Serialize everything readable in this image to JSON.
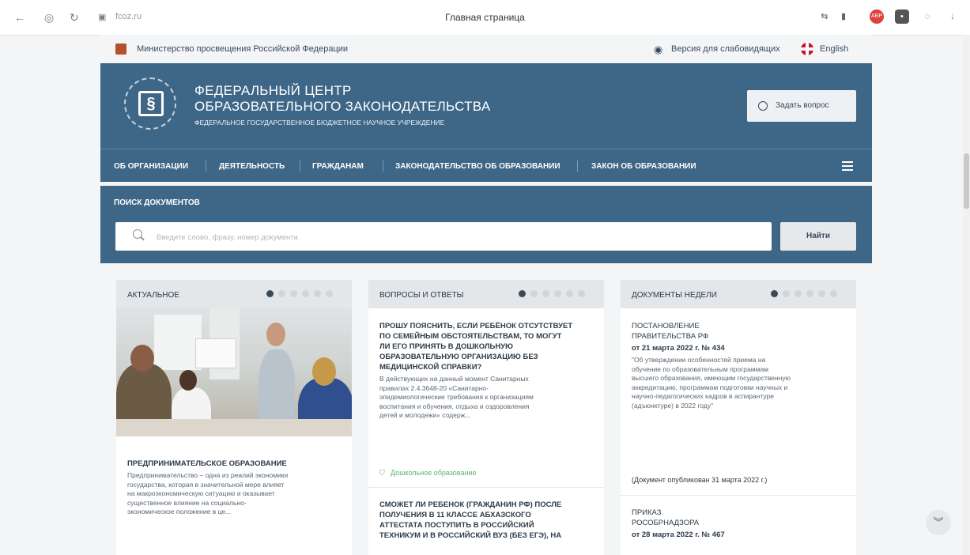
{
  "browser": {
    "url": "fcoz.ru",
    "tab_title": "Главная страница",
    "icons": [
      "back-icon",
      "shield-icon",
      "reload-icon",
      "lock-icon",
      "translate-icon",
      "bookmark-icon",
      "adblock-icon",
      "extension-icon",
      "chat-icon",
      "download-icon"
    ]
  },
  "topline": {
    "ministry": "Министерство просвещения Российской Федерации",
    "low_vision": "Версия для слабовидящих",
    "english": "English"
  },
  "header": {
    "title_line1": "ФЕДЕРАЛЬНЫЙ ЦЕНТР",
    "title_line2": "ОБРАЗОВАТЕЛЬНОГО ЗАКОНОДАТЕЛЬСТВА",
    "subtitle": "ФЕДЕРАЛЬНОЕ ГОСУДАРСТВЕННОЕ БЮДЖЕТНОЕ НАУЧНОЕ УЧРЕЖДЕНИЕ",
    "ask_label": "Задать вопрос"
  },
  "nav": {
    "items": [
      "ОБ ОРГАНИЗАЦИИ",
      "ДЕЯТЕЛЬНОСТЬ",
      "ГРАЖДАНАМ",
      "ЗАКОНОДАТЕЛЬСТВО ОБ ОБРАЗОВАНИИ",
      "ЗАКОН ОБ ОБРАЗОВАНИИ"
    ]
  },
  "search": {
    "title": "ПОИСК ДОКУМЕНТОВ",
    "placeholder": "Введите слово, фразу, номер документа",
    "button": "Найти"
  },
  "columns": {
    "actual": {
      "title": "АКТУАЛЬНОЕ",
      "card_title": "ПРЕДПРИНИМАТЕЛЬСКОЕ ОБРАЗОВАНИЕ",
      "card_text_lines": [
        "Предпринимательство – одна из реалий экономики",
        "государства, которая в значительной мере влияет",
        "на макроэкономическую ситуацию и оказывает",
        "существенное влияние на социально-",
        "экономическое положение в це..."
      ]
    },
    "qa": {
      "title": "ВОПРОСЫ И ОТВЕТЫ",
      "q1_lines": [
        "ПРОШУ ПОЯСНИТЬ, ЕСЛИ РЕБЁНОК ОТСУТСТВУЕТ",
        "ПО СЕМЕЙНЫМ ОБСТОЯТЕЛЬСТВАМ, ТО МОГУТ",
        "ЛИ ЕГО ПРИНЯТЬ В ДОШКОЛЬНУЮ",
        "ОБРАЗОВАТЕЛЬНУЮ ОРГАНИЗАЦИЮ БЕЗ",
        "МЕДИЦИНСКОЙ СПРАВКИ?"
      ],
      "a1_lines": [
        "В действующих на данный момент Санитарных",
        "правилах 2.4.3648-20 «Санитарно-",
        "эпидемиологические требования к организациям",
        "воспитания и обучения, отдыха и оздоровления",
        "детей и молодежи» содерж..."
      ],
      "tag": "Дошкольное образование",
      "q2_lines": [
        "СМОЖЕТ ЛИ РЕБЕНОК (ГРАЖДАНИН РФ) ПОСЛЕ",
        "ПОЛУЧЕНИЯ В 11 КЛАССЕ АБХАЗСКОГО",
        "АТТЕСТАТА ПОСТУПИТЬ В РОССИЙСКИЙ",
        "ТЕХНИКУМ И В РОССИЙСКИЙ ВУЗ (БЕЗ ЕГЭ), НА"
      ]
    },
    "docs": {
      "title": "ДОКУМЕНТЫ НЕДЕЛИ",
      "d1_type_lines": [
        "ПОСТАНОВЛЕНИЕ",
        "ПРАВИТЕЛЬСТВА РФ"
      ],
      "d1_date": "от 21 марта 2022 г. № 434",
      "d1_text_lines": [
        "\"Об утверждении особенностей приема на",
        "обучение по образовательным программам",
        "высшего образования, имеющим государственную",
        "аккредитацию, программам подготовки научных и",
        "научно-педагогических кадров в аспирантуре",
        "(адъюнктуре) в 2022 году\""
      ],
      "d1_published": "(Документ опубликован 31 марта 2022 г.)",
      "d2_type_lines": [
        "ПРИКАЗ",
        "РОСОБРНАДЗОРА"
      ],
      "d2_date": "от 28 марта 2022 г. № 467"
    }
  },
  "colors": {
    "header_bg": "#3e6686",
    "page_bg": "#f4f5f7",
    "tag_green": "#5bb36b"
  }
}
